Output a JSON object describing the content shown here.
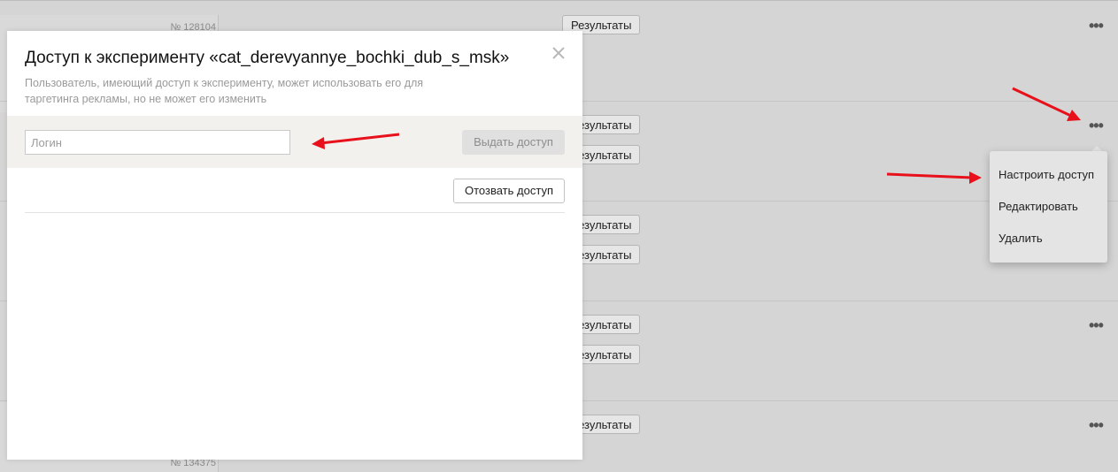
{
  "background": {
    "card_numbers": [
      "№ 128104",
      "№ 134375"
    ],
    "results_label": "Результаты",
    "more_icon": "more-dots-icon"
  },
  "modal": {
    "title": "Доступ к эксперименту «cat_derevyannye_bochki_dub_s_msk»",
    "description": "Пользователь, имеющий доступ к эксперименту, может использовать его для таргетинга рекламы, но не может его изменить",
    "login_placeholder": "Логин",
    "login_value": "",
    "grant_button": "Выдать доступ",
    "revoke_button": "Отозвать доступ",
    "close_icon": "close-icon"
  },
  "menu": {
    "items": [
      {
        "label": "Настроить доступ"
      },
      {
        "label": "Редактировать"
      },
      {
        "label": "Удалить"
      }
    ]
  },
  "colors": {
    "annotation_arrow": "#e8101a",
    "page_background": "#d5d5d5",
    "modal_band": "#f2f1ee"
  }
}
